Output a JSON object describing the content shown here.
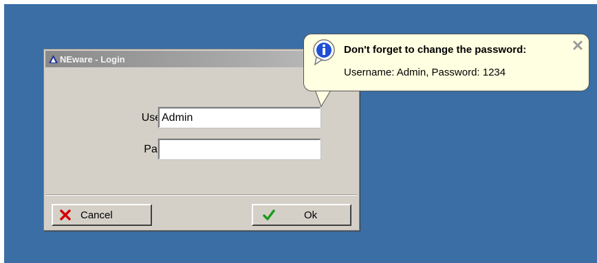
{
  "window": {
    "title": "NEware - Login"
  },
  "form": {
    "username_label": "Username:",
    "username_value": "Admin",
    "password_label": "Password:",
    "password_value": ""
  },
  "buttons": {
    "cancel_label": "Cancel",
    "cancel_icon": "red-x-icon",
    "ok_label": "Ok",
    "ok_icon": "green-check-icon"
  },
  "balloon": {
    "title": "Don't forget to change the password:",
    "message": "Username: Admin, Password: 1234",
    "icon": "info-icon"
  },
  "colors": {
    "desktop": "#3a6ea5",
    "window": "#d4d0c8",
    "balloon": "#ffffe1"
  }
}
